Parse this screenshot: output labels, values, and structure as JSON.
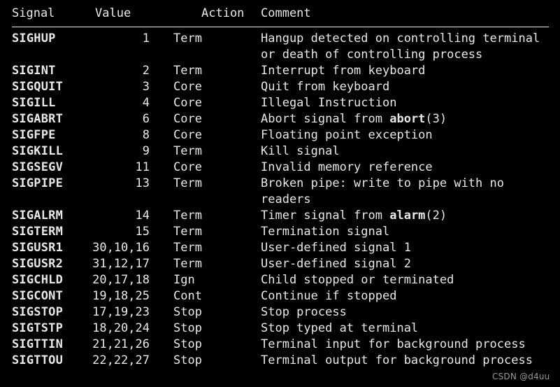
{
  "table": {
    "columns": [
      "Signal",
      "Value",
      "Action",
      "Comment"
    ],
    "rows": [
      {
        "signal": "SIGHUP",
        "value": "1",
        "action": "Term",
        "comment_pre": "Hangup detected on controlling terminal or death of controlling process",
        "comment_bold": "",
        "comment_post": ""
      },
      {
        "signal": "SIGINT",
        "value": "2",
        "action": "Term",
        "comment_pre": "Interrupt from keyboard",
        "comment_bold": "",
        "comment_post": ""
      },
      {
        "signal": "SIGQUIT",
        "value": "3",
        "action": "Core",
        "comment_pre": "Quit from keyboard",
        "comment_bold": "",
        "comment_post": ""
      },
      {
        "signal": "SIGILL",
        "value": "4",
        "action": "Core",
        "comment_pre": "Illegal Instruction",
        "comment_bold": "",
        "comment_post": ""
      },
      {
        "signal": "SIGABRT",
        "value": "6",
        "action": "Core",
        "comment_pre": "Abort signal from ",
        "comment_bold": "abort",
        "comment_post": "(3)"
      },
      {
        "signal": "SIGFPE",
        "value": "8",
        "action": "Core",
        "comment_pre": "Floating point exception",
        "comment_bold": "",
        "comment_post": ""
      },
      {
        "signal": "SIGKILL",
        "value": "9",
        "action": "Term",
        "comment_pre": "Kill signal",
        "comment_bold": "",
        "comment_post": ""
      },
      {
        "signal": "SIGSEGV",
        "value": "11",
        "action": "Core",
        "comment_pre": "Invalid memory reference",
        "comment_bold": "",
        "comment_post": ""
      },
      {
        "signal": "SIGPIPE",
        "value": "13",
        "action": "Term",
        "comment_pre": "Broken pipe: write to pipe with no readers",
        "comment_bold": "",
        "comment_post": ""
      },
      {
        "signal": "SIGALRM",
        "value": "14",
        "action": "Term",
        "comment_pre": "Timer signal from ",
        "comment_bold": "alarm",
        "comment_post": "(2)"
      },
      {
        "signal": "SIGTERM",
        "value": "15",
        "action": "Term",
        "comment_pre": "Termination signal",
        "comment_bold": "",
        "comment_post": ""
      },
      {
        "signal": "SIGUSR1",
        "value": "30,10,16",
        "action": "Term",
        "comment_pre": "User-defined signal 1",
        "comment_bold": "",
        "comment_post": ""
      },
      {
        "signal": "SIGUSR2",
        "value": "31,12,17",
        "action": "Term",
        "comment_pre": "User-defined signal 2",
        "comment_bold": "",
        "comment_post": ""
      },
      {
        "signal": "SIGCHLD",
        "value": "20,17,18",
        "action": "Ign",
        "comment_pre": "Child stopped or terminated",
        "comment_bold": "",
        "comment_post": ""
      },
      {
        "signal": "SIGCONT",
        "value": "19,18,25",
        "action": "Cont",
        "comment_pre": "Continue if stopped",
        "comment_bold": "",
        "comment_post": ""
      },
      {
        "signal": "SIGSTOP",
        "value": "17,19,23",
        "action": "Stop",
        "comment_pre": "Stop process",
        "comment_bold": "",
        "comment_post": ""
      },
      {
        "signal": "SIGTSTP",
        "value": "18,20,24",
        "action": "Stop",
        "comment_pre": "Stop typed at terminal",
        "comment_bold": "",
        "comment_post": ""
      },
      {
        "signal": "SIGTTIN",
        "value": "21,21,26",
        "action": "Stop",
        "comment_pre": "Terminal input for background process",
        "comment_bold": "",
        "comment_post": ""
      },
      {
        "signal": "SIGTTOU",
        "value": "22,22,27",
        "action": "Stop",
        "comment_pre": "Terminal output for background process",
        "comment_bold": "",
        "comment_post": ""
      }
    ]
  },
  "watermark": {
    "text": "CSDN @d4uu"
  },
  "colors": {
    "background": "#000000",
    "text": "#e8e8e8",
    "rule": "#f2f2f2",
    "watermark": "#9a9a9a"
  }
}
